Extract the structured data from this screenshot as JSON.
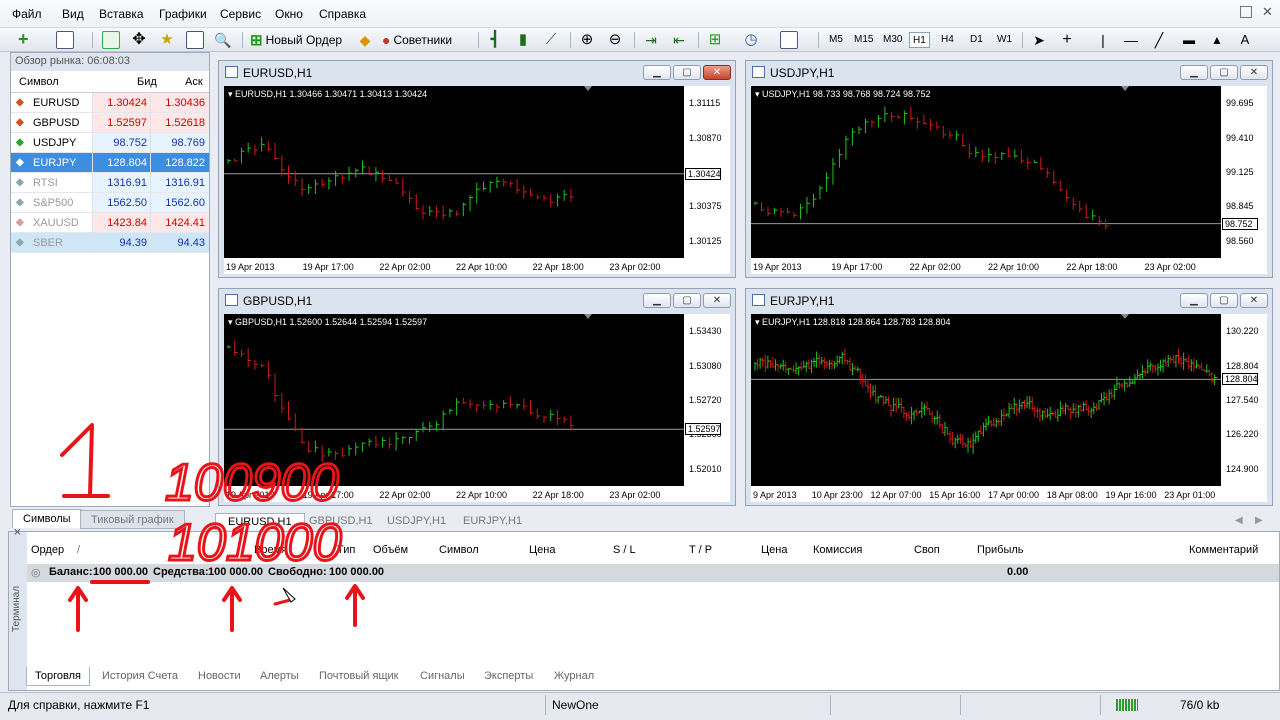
{
  "menu": [
    "Файл",
    "Вид",
    "Вставка",
    "Графики",
    "Сервис",
    "Окно",
    "Справка"
  ],
  "toolbar": {
    "new_order": "Новый Ордер",
    "advisors": "Советники",
    "timeframes": [
      "M5",
      "M15",
      "M30",
      "H1",
      "H4",
      "D1",
      "W1"
    ]
  },
  "market_watch": {
    "title": "Обзор рынка: 06:08:03",
    "col_symbol": "Символ",
    "col_bid": "Бид",
    "col_ask": "Аск",
    "rows": [
      {
        "symbol": "EURUSD",
        "bid": "1.30424",
        "ask": "1.30436"
      },
      {
        "symbol": "GBPUSD",
        "bid": "1.52597",
        "ask": "1.52618"
      },
      {
        "symbol": "USDJPY",
        "bid": "98.752",
        "ask": "98.769"
      },
      {
        "symbol": "EURJPY",
        "bid": "128.804",
        "ask": "128.822"
      },
      {
        "symbol": "RTSI",
        "bid": "1316.91",
        "ask": "1316.91"
      },
      {
        "symbol": "S&P500",
        "bid": "1562.50",
        "ask": "1562.60"
      },
      {
        "symbol": "XAUUSD",
        "bid": "1423.84",
        "ask": "1424.41"
      },
      {
        "symbol": "SBER",
        "bid": "94.39",
        "ask": "94.43"
      }
    ],
    "tabs": [
      "Символы",
      "Тиковый график"
    ]
  },
  "charts": [
    {
      "title": "EURUSD,H1",
      "info": "EURUSD,H1  1.30466 1.30471 1.30413 1.30424",
      "yticks": [
        "1.31115",
        "1.30870",
        "1.30620",
        "1.30375",
        "1.30125"
      ],
      "price": "1.30424",
      "xticks": [
        "19 Apr 2013",
        "19 Apr 17:00",
        "22 Apr 02:00",
        "22 Apr 10:00",
        "22 Apr 18:00",
        "23 Apr 02:00"
      ]
    },
    {
      "title": "USDJPY,H1",
      "info": "USDJPY,H1  98.733 98.768 98.724 98.752",
      "yticks": [
        "99.695",
        "99.410",
        "99.125",
        "98.845",
        "98.560"
      ],
      "price": "98.752",
      "xticks": [
        "19 Apr 2013",
        "19 Apr 17:00",
        "22 Apr 02:00",
        "22 Apr 10:00",
        "22 Apr 18:00",
        "23 Apr 02:00"
      ]
    },
    {
      "title": "GBPUSD,H1",
      "info": "GBPUSD,H1  1.52600 1.52644 1.52594 1.52597",
      "yticks": [
        "1.53430",
        "1.53080",
        "1.52720",
        "1.52360",
        "1.52010"
      ],
      "price": "1.52597",
      "xticks": [
        "19 Apr 2013",
        "19 Apr 17:00",
        "22 Apr 02:00",
        "22 Apr 10:00",
        "22 Apr 18:00",
        "23 Apr 02:00"
      ]
    },
    {
      "title": "EURJPY,H1",
      "info": "EURJPY,H1  128.818 128.864 128.783 128.804",
      "yticks": [
        "130.220",
        "128.804",
        "127.540",
        "126.220",
        "124.900"
      ],
      "price": "128.804",
      "xticks": [
        "9 Apr 2013",
        "10 Apr 23:00",
        "12 Apr 07:00",
        "15 Apr 16:00",
        "17 Apr 00:00",
        "18 Apr 08:00",
        "19 Apr 16:00",
        "23 Apr 01:00"
      ]
    }
  ],
  "chart_tabs": [
    "EURUSD,H1",
    "GBPUSD,H1",
    "USDJPY,H1",
    "EURJPY,H1"
  ],
  "terminal": {
    "side_label": "Терминал",
    "headers": [
      "Ордер",
      "/",
      "Время",
      "Тип",
      "Объём",
      "Символ",
      "Цена",
      "S / L",
      "T / P",
      "Цена",
      "Комиссия",
      "Своп",
      "Прибыль",
      "Комментарий"
    ],
    "balance_label": "Баланс:",
    "balance": "100 000.00",
    "equity_label": "Средства:",
    "equity": "100 000.00",
    "free_label": "Свободно:",
    "free": "100 000.00",
    "profit": "0.00",
    "tabs": [
      "Торговля",
      "История Счета",
      "Новости",
      "Алерты",
      "Почтовый ящик",
      "Сигналы",
      "Эксперты",
      "Журнал"
    ]
  },
  "status": {
    "help": "Для справки, нажмите F1",
    "profile": "NewOne",
    "traffic": "76/0 kb"
  },
  "annotations": {
    "big_digit": "1",
    "num_top": "100900",
    "num_bottom": "101000"
  },
  "colors": {
    "bull": "#22c322",
    "bear": "#d21a1a",
    "bull_arrow": "#27a627",
    "bear_arrow": "#d45222",
    "ink": "#e8141a"
  }
}
